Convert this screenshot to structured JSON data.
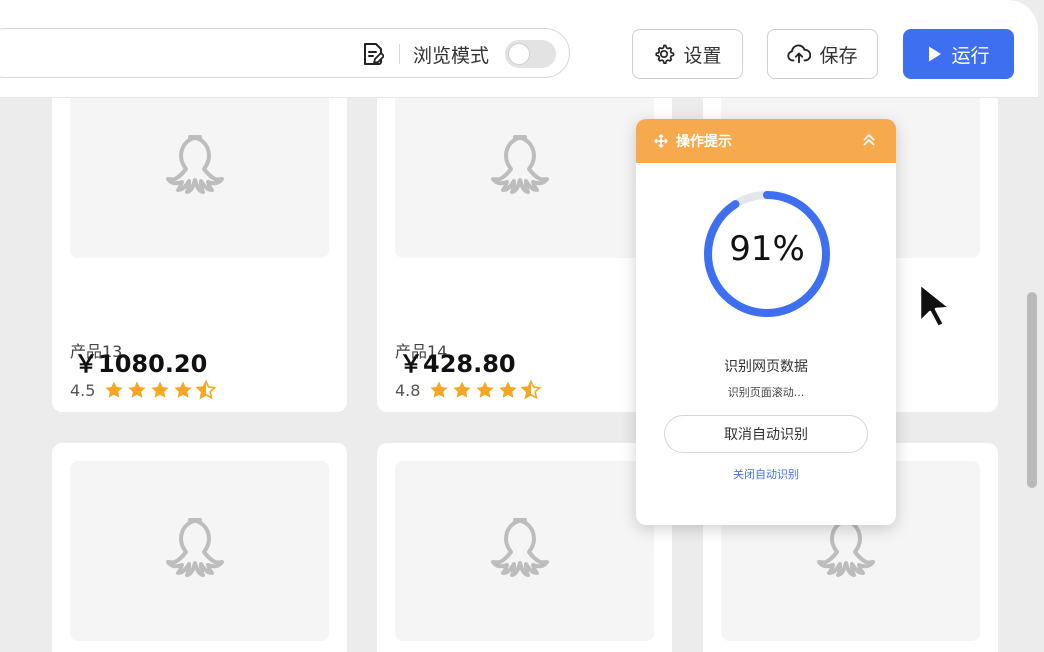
{
  "toolbar": {
    "browse_label": "浏览模式",
    "browse_toggle_on": false,
    "settings_label": "设置",
    "save_label": "保存",
    "run_label": "运行",
    "accent": "#3e6ff0"
  },
  "products": [
    {
      "name": "产品13",
      "rating": "4.5",
      "price": "￥1080.20"
    },
    {
      "name": "产品14",
      "rating": "4.8",
      "price": "￥428.80"
    },
    {
      "name": "",
      "rating": "",
      "price": ""
    },
    {
      "name": "",
      "rating": "",
      "price": ""
    },
    {
      "name": "",
      "rating": "",
      "price": ""
    },
    {
      "name": "",
      "rating": "",
      "price": ""
    }
  ],
  "panel": {
    "title": "操作提示",
    "progress_percent": 91,
    "progress_text": "91%",
    "status_title": "识别网页数据",
    "status_sub": "识别页面滚动...",
    "cancel_label": "取消自动识别",
    "close_label": "关闭自动识别",
    "header_color": "#f6a94d",
    "ring_color": "#3e6ff0"
  },
  "icons": {
    "edit": "edit-doc-icon",
    "settings": "gear-icon",
    "save": "cloud-upload-icon",
    "run": "play-icon",
    "star": "star-icon",
    "half_star": "half-star-icon",
    "placeholder": "octopus-placeholder-icon",
    "move": "move-icon",
    "collapse": "chevron-up-double-icon",
    "cursor": "mouse-pointer-icon"
  }
}
